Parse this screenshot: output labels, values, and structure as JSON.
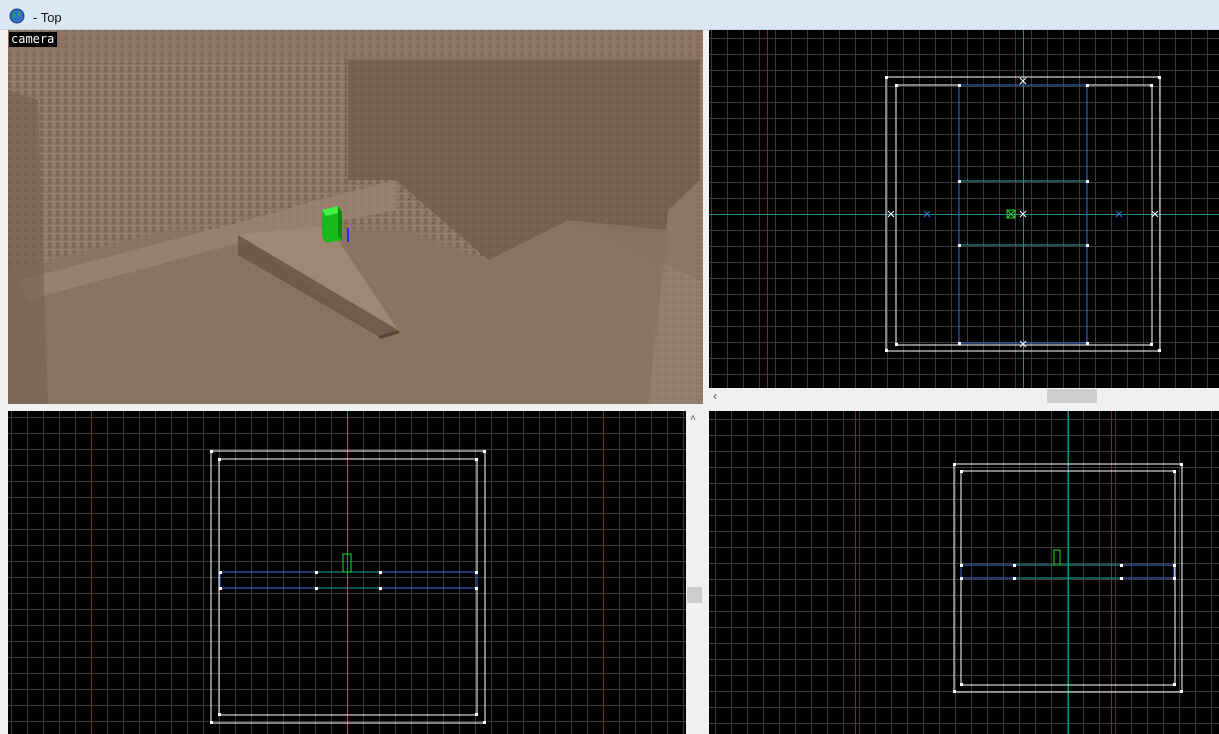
{
  "window": {
    "title": "- Top"
  },
  "camera_view": {
    "label": "camera"
  },
  "icons": {
    "app": "globe-icon",
    "scroll_left": "chevron-left-icon",
    "scroll_up": "chevron-up-icon"
  },
  "colors": {
    "grid_minor": "#3a3a3a",
    "grid_major_red": "#7a2a2a",
    "axis_cyan": "#1f8a8a",
    "brush_white": "#ffffff",
    "brush_blue": "#3d6fd6",
    "entity_green": "#22dd22",
    "wall_texture": "#8f7561"
  },
  "glyphs": {
    "scroll_left": "‹",
    "scroll_up": "˄"
  }
}
